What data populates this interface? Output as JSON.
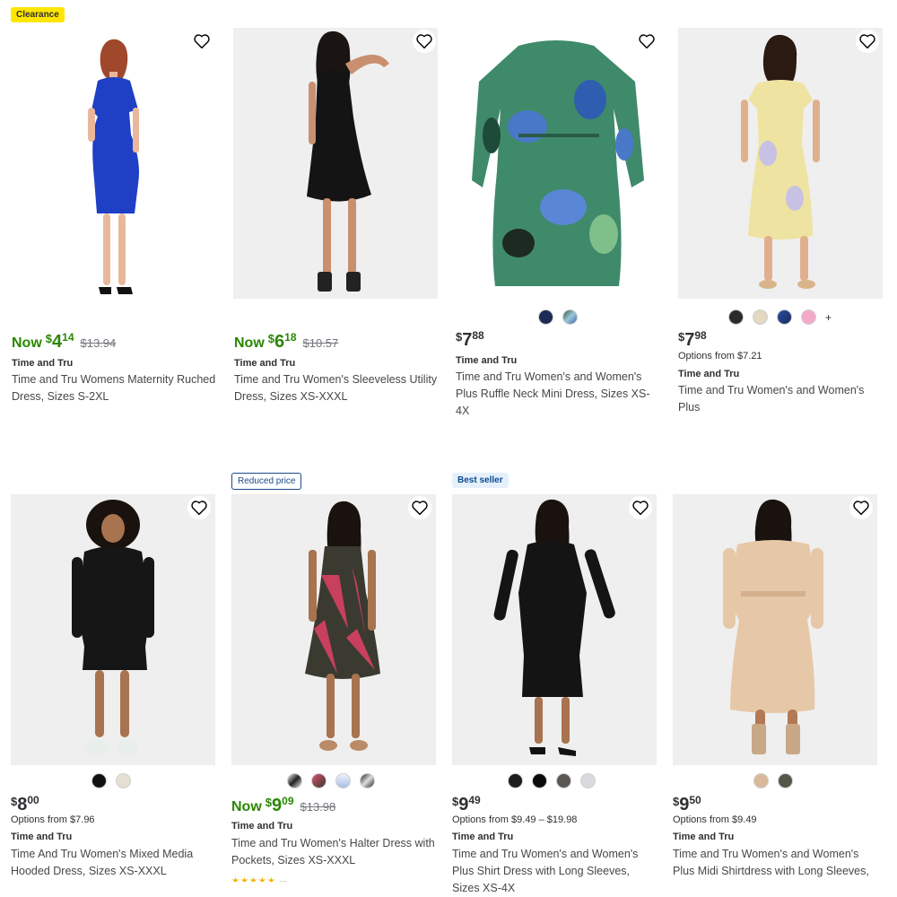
{
  "products": [
    {
      "badge": "Clearance",
      "now_label": "Now",
      "currency": "$",
      "price_dollars": "4",
      "price_cents": "14",
      "was_price": "$13.94",
      "brand": "Time and Tru",
      "title": "Time and Tru Womens Maternity Ruched Dress, Sizes S-2XL",
      "dress_color": "#1f3fc4"
    },
    {
      "now_label": "Now",
      "currency": "$",
      "price_dollars": "6",
      "price_cents": "18",
      "was_price": "$10.57",
      "brand": "Time and Tru",
      "title": "Time and Tru Women's Sleeveless Utility Dress, Sizes XS-XXXL",
      "dress_color": "#141414"
    },
    {
      "currency": "$",
      "price_dollars": "7",
      "price_cents": "88",
      "brand": "Time and Tru",
      "title": "Time and Tru Women's and Women's Plus Ruffle Neck Mini Dress, Sizes XS-4X",
      "swatches": [
        "#1c2a55",
        "#4d8a9a"
      ],
      "dress_color": "#3f8a6a"
    },
    {
      "currency": "$",
      "price_dollars": "7",
      "price_cents": "98",
      "options": "Options from $7.21",
      "brand": "Time and Tru",
      "title": "Time and Tru Women's and Women's Plus",
      "swatches": [
        "#2b2b2b",
        "#e3d8c0",
        "#2a4fa0",
        "#f5a9c8"
      ],
      "more": "+",
      "dress_color": "#efe3a2"
    },
    {
      "currency": "$",
      "price_dollars": "8",
      "price_cents": "00",
      "options": "Options from $7.96",
      "brand": "Time and Tru",
      "title": "Time And Tru Women's Mixed Media Hooded Dress, Sizes XS-XXXL",
      "swatches": [
        "#111111",
        "#e6e0d2"
      ],
      "dress_color": "#161616"
    },
    {
      "badge": "Reduced price",
      "now_label": "Now",
      "currency": "$",
      "price_dollars": "9",
      "price_cents": "09",
      "was_price": "$13.98",
      "brand": "Time and Tru",
      "title": "Time and Tru Women's Halter Dress with Pockets, Sizes XS-XXXL",
      "swatches": [
        "#3a3a3a",
        "#d9506f",
        "#a9bde6",
        "#222222"
      ],
      "dress_color": "#c8405e"
    },
    {
      "badge": "Best seller",
      "currency": "$",
      "price_dollars": "9",
      "price_cents": "49",
      "options": "Options from $9.49 – $19.98",
      "brand": "Time and Tru",
      "title": "Time and Tru Women's and Women's Plus Shirt Dress with Long Sleeves, Sizes XS-4X",
      "swatches": [
        "#1b1b1b",
        "#0a0a0a",
        "#5a5652",
        "#d8dae0"
      ],
      "dress_color": "#141414"
    },
    {
      "currency": "$",
      "price_dollars": "9",
      "price_cents": "50",
      "options": "Options from $9.49",
      "brand": "Time and Tru",
      "title": "Time and Tru Women's and Women's Plus Midi Shirtdress with Long Sleeves, Sizes",
      "swatches": [
        "#d9b998",
        "#55574a"
      ],
      "dress_color": "#e6c8a8"
    }
  ],
  "icons": {
    "favorite": "heart-outline-icon"
  },
  "colors": {
    "sale_green": "#2a8703",
    "clearance_yellow": "#ffe600",
    "text": "#2e2f32",
    "muted": "#74767c"
  }
}
